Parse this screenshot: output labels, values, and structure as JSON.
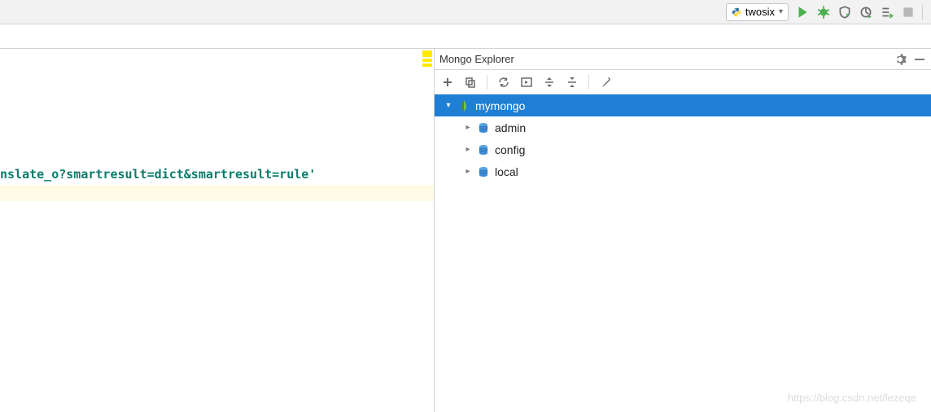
{
  "run_config": {
    "label": "twosix"
  },
  "editor": {
    "visible_code": "nslate_o?smartresult=dict&smartresult=rule'"
  },
  "mongo_panel": {
    "title": "Mongo Explorer",
    "connection": {
      "label": "mymongo",
      "expanded": true,
      "selected": true
    },
    "databases": [
      {
        "label": "admin"
      },
      {
        "label": "config"
      },
      {
        "label": "local"
      }
    ]
  },
  "watermark": "https://blog.csdn.net/lezeqe"
}
